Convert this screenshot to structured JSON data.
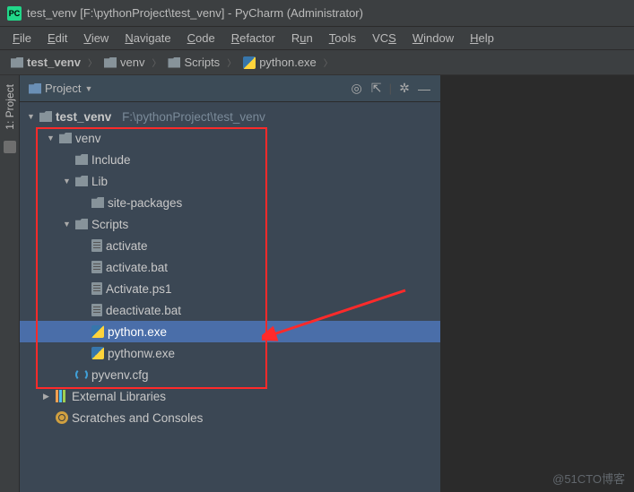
{
  "window": {
    "title": "test_venv [F:\\pythonProject\\test_venv] - PyCharm (Administrator)"
  },
  "menu": {
    "file": "File",
    "edit": "Edit",
    "view": "View",
    "navigate": "Navigate",
    "code": "Code",
    "refactor": "Refactor",
    "run": "Run",
    "tools": "Tools",
    "vcs": "VCS",
    "window": "Window",
    "help": "Help"
  },
  "breadcrumb": {
    "root": "test_venv",
    "p1": "venv",
    "p2": "Scripts",
    "p3": "python.exe"
  },
  "panel": {
    "title": "Project"
  },
  "sidebar": {
    "label": "1: Project"
  },
  "tree": {
    "root": {
      "name": "test_venv",
      "path": "F:\\pythonProject\\test_venv"
    },
    "venv": "venv",
    "include": "Include",
    "lib": "Lib",
    "sitepkg": "site-packages",
    "scripts": "Scripts",
    "activate": "activate",
    "activatebat": "activate.bat",
    "activateps1": "Activate.ps1",
    "deactivatebat": "deactivate.bat",
    "pythonexe": "python.exe",
    "pythonwexe": "pythonw.exe",
    "pyvenv": "pyvenv.cfg",
    "extlibs": "External Libraries",
    "scratches": "Scratches and Consoles"
  },
  "watermark": "@51CTO博客"
}
